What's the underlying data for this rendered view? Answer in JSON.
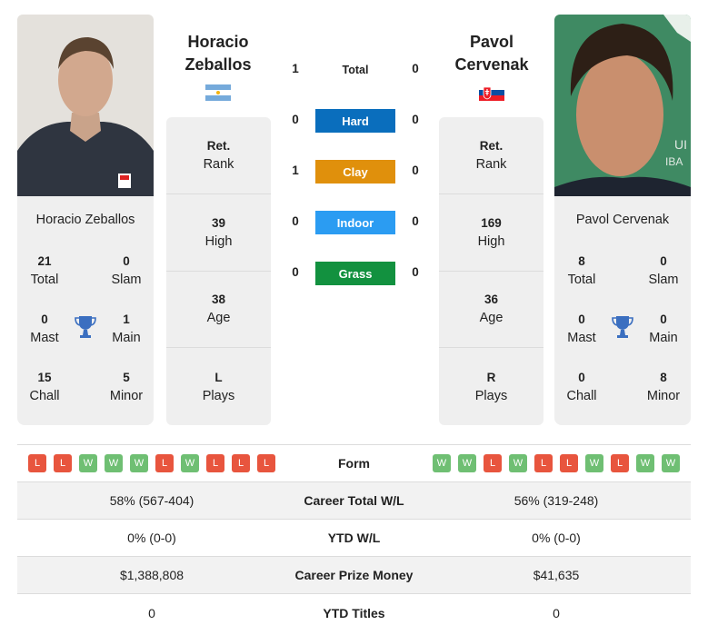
{
  "players": {
    "left": {
      "name": "Horacio Zeballos",
      "header_first": "Horacio",
      "header_last": "Zeballos",
      "country_flag": "argentina-flag",
      "titles": {
        "total": "21",
        "slam": "0",
        "mast": "0",
        "main": "1",
        "chall": "15",
        "minor": "5"
      },
      "rank": "Ret.",
      "high": "39",
      "age": "38",
      "plays": "L",
      "form": [
        "L",
        "L",
        "W",
        "W",
        "W",
        "L",
        "W",
        "L",
        "L",
        "L"
      ],
      "career_wl": "58% (567-404)",
      "ytd_wl": "0% (0-0)",
      "prize_money": "$1,388,808",
      "ytd_titles": "0"
    },
    "right": {
      "name": "Pavol Cervenak",
      "header_first": "Pavol",
      "header_last": "Cervenak",
      "country_flag": "slovakia-flag",
      "titles": {
        "total": "8",
        "slam": "0",
        "mast": "0",
        "main": "0",
        "chall": "0",
        "minor": "8"
      },
      "rank": "Ret.",
      "high": "169",
      "age": "36",
      "plays": "R",
      "form": [
        "W",
        "W",
        "L",
        "W",
        "L",
        "L",
        "W",
        "L",
        "W",
        "W"
      ],
      "career_wl": "56% (319-248)",
      "ytd_wl": "0% (0-0)",
      "prize_money": "$41,635",
      "ytd_titles": "0"
    }
  },
  "labels": {
    "total": "Total",
    "slam": "Slam",
    "mast": "Mast",
    "main": "Main",
    "chall": "Chall",
    "minor": "Minor",
    "rank": "Rank",
    "high": "High",
    "age": "Age",
    "plays": "Plays",
    "form": "Form",
    "career_wl": "Career Total W/L",
    "ytd_wl": "YTD W/L",
    "prize_money": "Career Prize Money",
    "ytd_titles": "YTD Titles"
  },
  "h2h": [
    {
      "surface": "Total",
      "left": "1",
      "right": "0",
      "color": ""
    },
    {
      "surface": "Hard",
      "left": "0",
      "right": "0",
      "color": "#0a6ebd"
    },
    {
      "surface": "Clay",
      "left": "1",
      "right": "0",
      "color": "#e0900c"
    },
    {
      "surface": "Indoor",
      "left": "0",
      "right": "0",
      "color": "#2b9cf2"
    },
    {
      "surface": "Grass",
      "left": "0",
      "right": "0",
      "color": "#12913f"
    }
  ]
}
